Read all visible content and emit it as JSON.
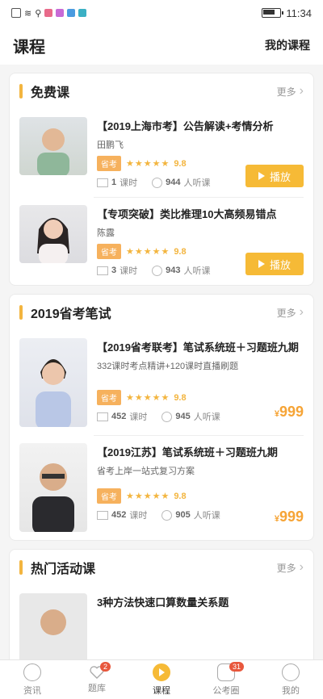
{
  "status": {
    "time": "11:34"
  },
  "header": {
    "title": "课程",
    "my_courses": "我的课程"
  },
  "sections": [
    {
      "title": "免费课",
      "more": "更多",
      "items": [
        {
          "title": "【2019上海市考】公告解读+考情分析",
          "teacher": "田鹏飞",
          "tag": "省考",
          "score": "9.8",
          "lessons": "1",
          "lessons_unit": "课时",
          "listeners": "944",
          "listeners_unit": "人听课",
          "action": "播放"
        },
        {
          "title": "【专项突破】类比推理10大高频易错点",
          "teacher": "陈露",
          "tag": "省考",
          "score": "9.8",
          "lessons": "3",
          "lessons_unit": "课时",
          "listeners": "943",
          "listeners_unit": "人听课",
          "action": "播放"
        }
      ]
    },
    {
      "title": "2019省考笔试",
      "more": "更多",
      "items": [
        {
          "title": "【2019省考联考】笔试系统班＋习题班九期",
          "desc": "332课时考点精讲+120课时直播刷题",
          "tag": "省考",
          "score": "9.8",
          "lessons": "452",
          "lessons_unit": "课时",
          "listeners": "945",
          "listeners_unit": "人听课",
          "currency": "¥",
          "price": "999"
        },
        {
          "title": "【2019江苏】笔试系统班＋习题班九期",
          "desc": "省考上岸一站式复习方案",
          "tag": "省考",
          "score": "9.8",
          "lessons": "452",
          "lessons_unit": "课时",
          "listeners": "905",
          "listeners_unit": "人听课",
          "currency": "¥",
          "price": "999"
        }
      ]
    },
    {
      "title": "热门活动课",
      "more": "更多",
      "items": [
        {
          "title": "3种方法快速口算数量关系题"
        }
      ]
    }
  ],
  "tabbar": [
    {
      "label": "资讯",
      "icon": "compass-icon"
    },
    {
      "label": "题库",
      "icon": "heart-icon",
      "badge": "2"
    },
    {
      "label": "课程",
      "icon": "play-icon",
      "active": true
    },
    {
      "label": "公考圈",
      "icon": "chat-icon",
      "badge": "31"
    },
    {
      "label": "我的",
      "icon": "user-icon"
    }
  ],
  "stars": "★★★★★"
}
